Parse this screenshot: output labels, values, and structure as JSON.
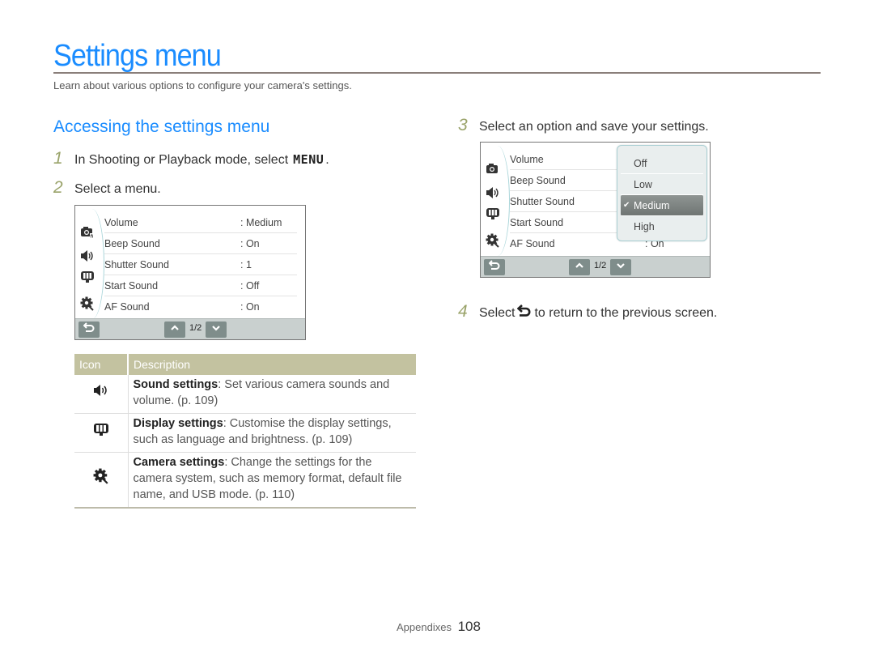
{
  "header": {
    "title": "Settings menu",
    "subtitle": "Learn about various options to configure your camera's settings."
  },
  "section": {
    "heading": "Accessing the settings menu"
  },
  "steps": [
    {
      "num": "1",
      "text": "In Shooting or Playback mode, select",
      "icon_text": "MENU",
      "suffix": "."
    },
    {
      "num": "2",
      "text": "Select a menu."
    },
    {
      "num": "3",
      "text": "Select an option and save your settings."
    },
    {
      "num": "4",
      "prefix": "Select",
      "text": "to return to the previous screen.",
      "icon": "back-icon"
    }
  ],
  "screen1": {
    "side_icons": [
      "camera-settings-icon",
      "sound-icon",
      "display-icon",
      "gear-icon"
    ],
    "rows": [
      {
        "label": "Volume",
        "value": ": Medium"
      },
      {
        "label": "Beep Sound",
        "value": ": On"
      },
      {
        "label": "Shutter Sound",
        "value": ": 1"
      },
      {
        "label": "Start Sound",
        "value": ": Off"
      },
      {
        "label": "AF Sound",
        "value": ": On"
      }
    ],
    "page_indicator": "1/2"
  },
  "screen2": {
    "rows": [
      {
        "label": "Volume",
        "value": ""
      },
      {
        "label": "Beep Sound",
        "value": ""
      },
      {
        "label": "Shutter Sound",
        "value": ""
      },
      {
        "label": "Start Sound",
        "value": ""
      },
      {
        "label": "AF Sound",
        "value": ": On"
      }
    ],
    "dropdown_options": [
      {
        "label": "Off",
        "selected": false
      },
      {
        "label": "Low",
        "selected": false
      },
      {
        "label": "Medium",
        "selected": true
      },
      {
        "label": "High",
        "selected": false
      }
    ],
    "page_indicator": "1/2"
  },
  "table": {
    "headers": [
      "Icon",
      "Description"
    ],
    "rows": [
      {
        "icon": "sound-icon",
        "title": "Sound settings",
        "desc": ": Set various camera sounds and volume. (p. 109)"
      },
      {
        "icon": "display-icon",
        "title": "Display settings",
        "desc": ": Customise the display settings, such as language and brightness. (p. 109)"
      },
      {
        "icon": "gear-icon",
        "title": "Camera settings",
        "desc": ": Change the settings for the camera system, such as memory format, default file name, and USB mode. (p. 110)"
      }
    ]
  },
  "footer": {
    "section": "Appendixes",
    "page": "108"
  }
}
